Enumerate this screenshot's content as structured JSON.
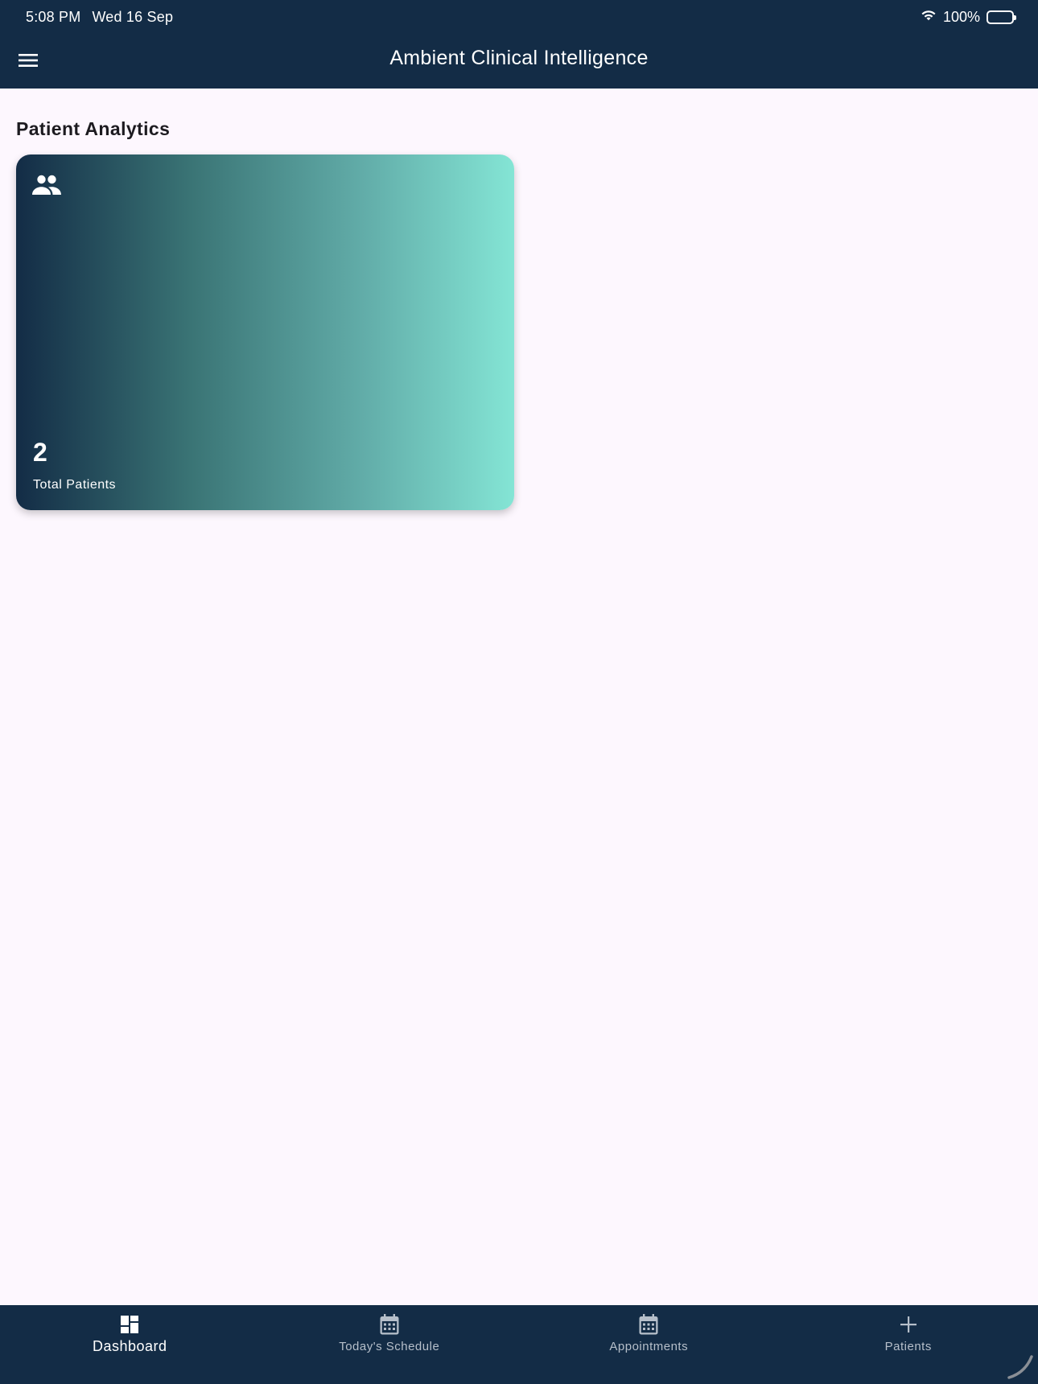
{
  "status_bar": {
    "time": "5:08 PM",
    "date": "Wed 16 Sep",
    "battery_text": "100%",
    "wifi_icon": "wifi-icon",
    "battery_icon": "battery-full-icon"
  },
  "app_bar": {
    "title": "Ambient Clinical Intelligence",
    "menu_icon": "hamburger-menu-icon"
  },
  "main": {
    "section_title": "Patient Analytics",
    "cards": [
      {
        "icon": "people-icon",
        "value": "2",
        "label": "Total Patients"
      }
    ]
  },
  "bottom_nav": {
    "items": [
      {
        "label": "Dashboard",
        "icon": "dashboard-icon",
        "active": true
      },
      {
        "label": "Today's Schedule",
        "icon": "calendar-icon",
        "active": false
      },
      {
        "label": "Appointments",
        "icon": "calendar-icon",
        "active": false
      },
      {
        "label": "Patients",
        "icon": "plus-icon",
        "active": false
      }
    ]
  },
  "colors": {
    "header_bg": "#132c46",
    "page_bg": "#fdf7fe",
    "card_gradient_start": "#132c46",
    "card_gradient_end": "#84e5d5",
    "nav_active": "#ffffff",
    "nav_inactive": "#b6bfca"
  }
}
